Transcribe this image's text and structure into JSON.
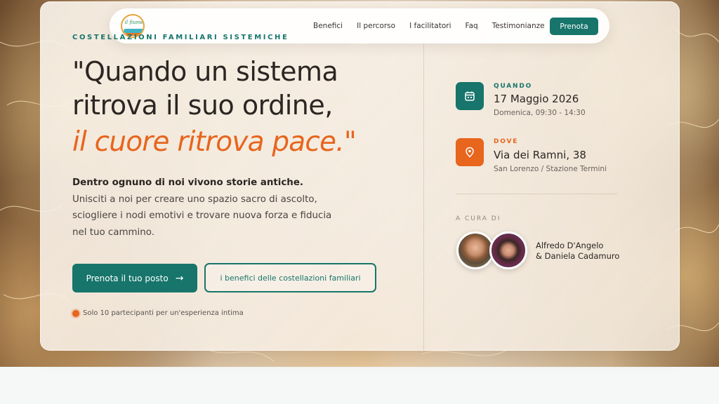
{
  "nav": {
    "logo_text": "il fiume",
    "links": [
      "Benefici",
      "Il percorso",
      "I facilitatori",
      "Faq",
      "Testimonianze"
    ],
    "cta": "Prenota"
  },
  "hero": {
    "eyebrow": "COSTELLAZIONI FAMILIARI SISTEMICHE",
    "headline_line1": "\"Quando un sistema",
    "headline_line2": "ritrova il suo ordine,",
    "headline_accent": "il cuore ritrova pace.\"",
    "lede_bold": "Dentro ognuno di noi vivono storie antiche.",
    "lede_rest": " Unisciti a noi per creare uno spazio sacro di ascolto, sciogliere i nodi emotivi e trovare nuova forza e fiducia nel tuo cammino.",
    "primary_button": "Prenota il tuo posto",
    "primary_arrow": "→",
    "secondary_button": "i benefici delle costellazioni familiari",
    "note": "Solo 10 partecipanti per un'esperienza intima"
  },
  "event": {
    "when_label": "QUANDO",
    "when_date": "17 Maggio 2026",
    "when_time": "Domenica, 09:30 - 14:30",
    "where_label": "DOVE",
    "where_address": "Via dei Ramni, 38",
    "where_area": "San Lorenzo / Stazione Termini",
    "curated_label": "A CURA DI",
    "facilitator_1": "Alfredo D'Angelo",
    "facilitator_2": "& Daniela Cadamuro"
  },
  "colors": {
    "brand_teal": "#17756b",
    "accent_orange": "#e7651d"
  },
  "icons": {
    "when": "calendar-icon",
    "where": "location-pin-icon",
    "note": "dot-icon"
  }
}
